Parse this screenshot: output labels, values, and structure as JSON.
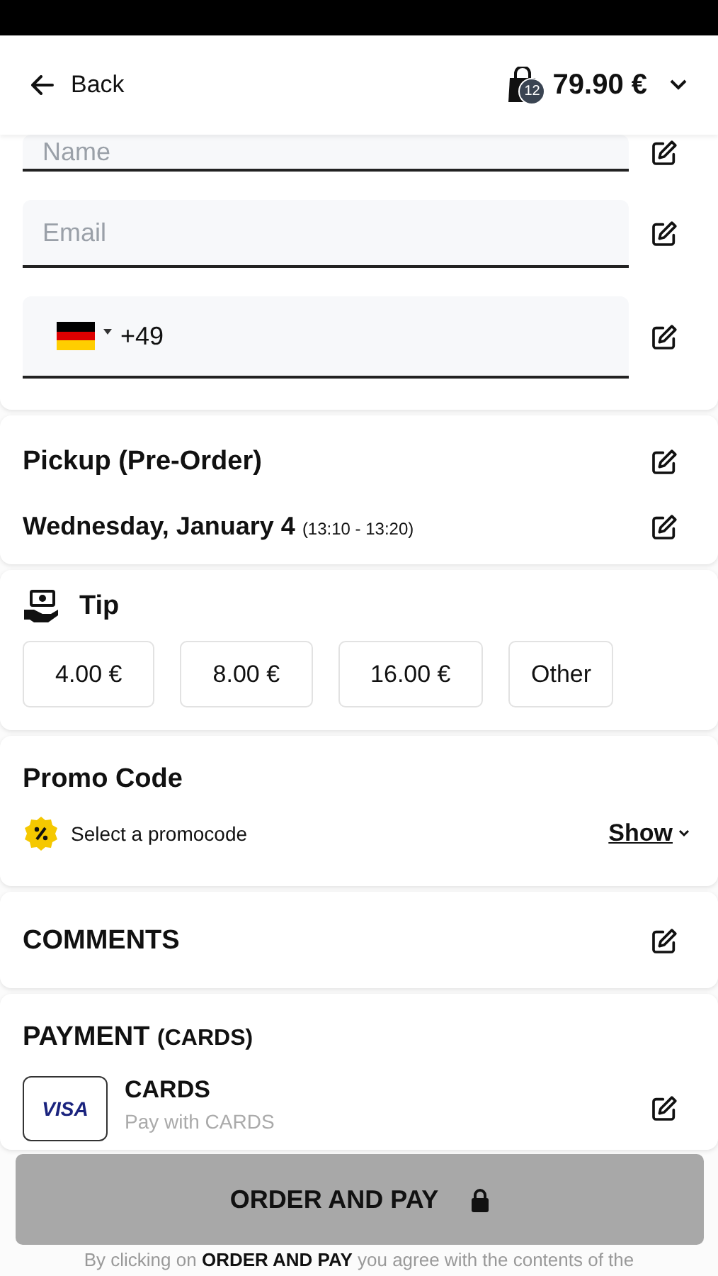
{
  "header": {
    "back_label": "Back",
    "cart_count": "12",
    "total": "79.90 €"
  },
  "contact_fields": [
    {
      "kind": "text",
      "placeholder": "Name"
    },
    {
      "kind": "text",
      "placeholder": "Email"
    },
    {
      "kind": "phone",
      "value": "+49"
    }
  ],
  "pickup": {
    "title": "Pickup (Pre-Order)",
    "date": "Wednesday, January 4",
    "time": "(13:10 - 13:20)"
  },
  "tip": {
    "title": "Tip",
    "options": [
      {
        "label": "4.00 €",
        "selected": false
      },
      {
        "label": "8.00 €",
        "selected": false
      },
      {
        "label": "16.00 €",
        "selected": false
      },
      {
        "label": "Other",
        "selected": false
      }
    ]
  },
  "promo": {
    "title": "Promo Code",
    "hint": "Select a promocode",
    "link": "Show"
  },
  "comments": {
    "title": "COMMENTS"
  },
  "payment": {
    "title": "PAYMENT",
    "title_suffix": "(CARDS)",
    "method": {
      "logo": "VISA",
      "name": "CARDS",
      "description": "Pay with CARDS"
    }
  },
  "order_button": {
    "label": "ORDER AND PAY"
  },
  "footer_note": "By clicking on **ORDER AND PAY** you agree with the contents of the"
}
